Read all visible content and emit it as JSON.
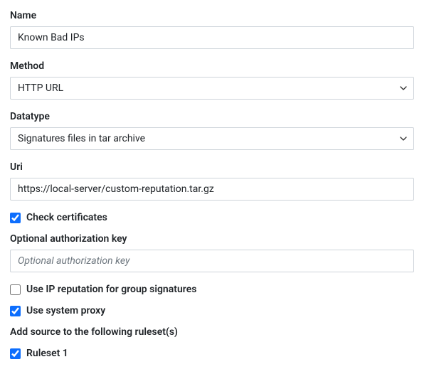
{
  "name": {
    "label": "Name",
    "value": "Known Bad IPs"
  },
  "method": {
    "label": "Method",
    "value": "HTTP URL"
  },
  "datatype": {
    "label": "Datatype",
    "value": "Signatures files in tar archive"
  },
  "uri": {
    "label": "Uri",
    "value": "https://local-server/custom-reputation.tar.gz"
  },
  "checkCertificates": {
    "label": "Check certificates",
    "checked": true
  },
  "authKey": {
    "label": "Optional authorization key",
    "placeholder": "Optional authorization key",
    "value": ""
  },
  "useIpReputation": {
    "label": "Use IP reputation for group signatures",
    "checked": false
  },
  "useSystemProxy": {
    "label": "Use system proxy",
    "checked": true
  },
  "rulesetHeading": "Add source to the following ruleset(s)",
  "ruleset1": {
    "label": "Ruleset 1",
    "checked": true
  }
}
